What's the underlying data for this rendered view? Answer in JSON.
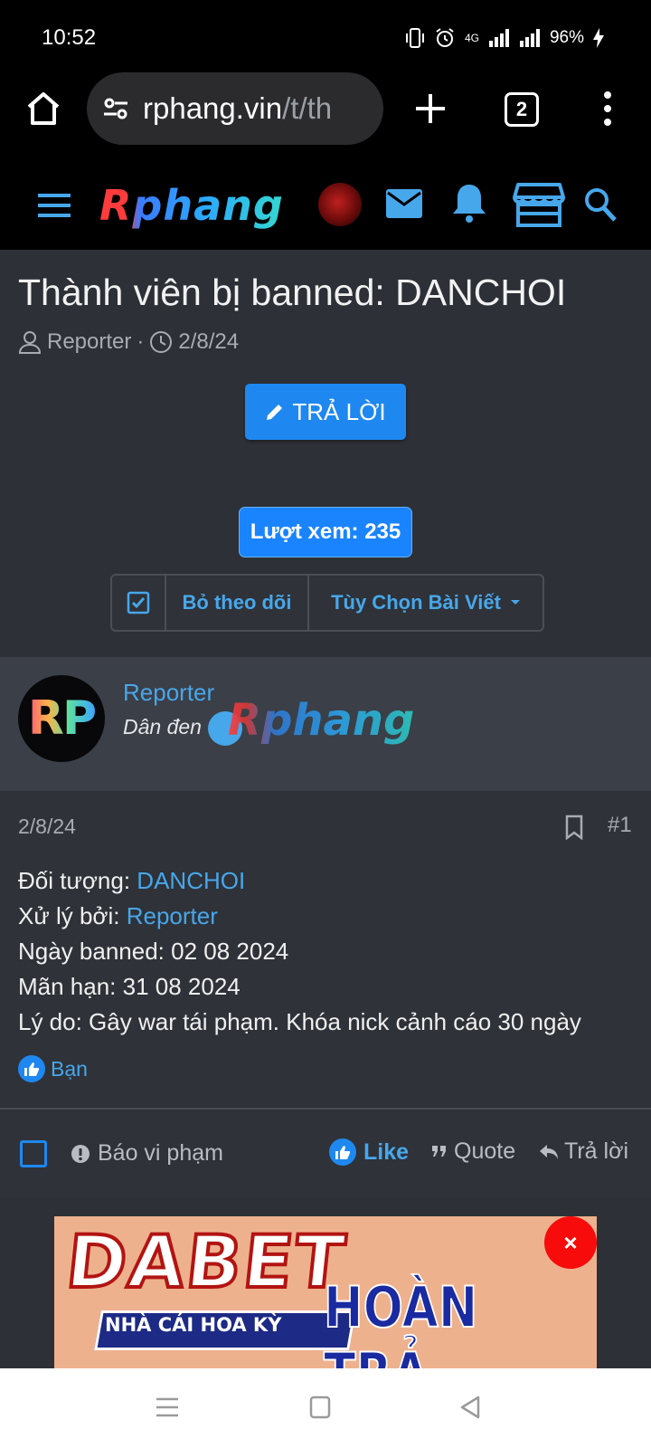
{
  "status": {
    "time": "10:52",
    "battery": "96%",
    "network": "4G"
  },
  "browser": {
    "url_main": "rphang.vin",
    "url_rest": "/t/th",
    "tab_count": "2"
  },
  "site": {
    "logo_text": "Rphang"
  },
  "thread": {
    "title": "Thành viên bị banned: DANCHOI",
    "author": "Reporter",
    "date": "2/8/24",
    "reply_button": "TRẢ LỜI",
    "views": "Lượt xem: 235",
    "unfollow": "Bỏ theo dõi",
    "options": "Tùy Chọn Bài Viết"
  },
  "post": {
    "avatar_text": "RP",
    "username": "Reporter",
    "user_title": "Dân đen",
    "banner_text": "Rphang",
    "date": "2/8/24",
    "number": "#1",
    "target_label": "Đối tượng: ",
    "target_value": "DANCHOI",
    "handled_label": "Xử lý bởi: ",
    "handled_value": "Reporter",
    "ban_date": "Ngày banned: 02 08 2024",
    "expiry": "Mãn hạn: 31 08 2024",
    "reason": "Lý do: Gây war tái phạm. Khóa nick cảnh cáo 30 ngày",
    "reaction_user": "Bạn"
  },
  "actions": {
    "report": "Báo vi phạm",
    "like": "Like",
    "quote": "Quote",
    "reply": "Trả lời"
  },
  "ad": {
    "brand": "DABET",
    "tagline": "NHÀ CÁI HOA KỲ",
    "headline": "HOÀN TRẢ",
    "close": "×"
  },
  "colors": {
    "accent": "#47a7eb",
    "button": "#1e88f0",
    "background": "#2d3036",
    "close_red": "#f70b0b"
  }
}
